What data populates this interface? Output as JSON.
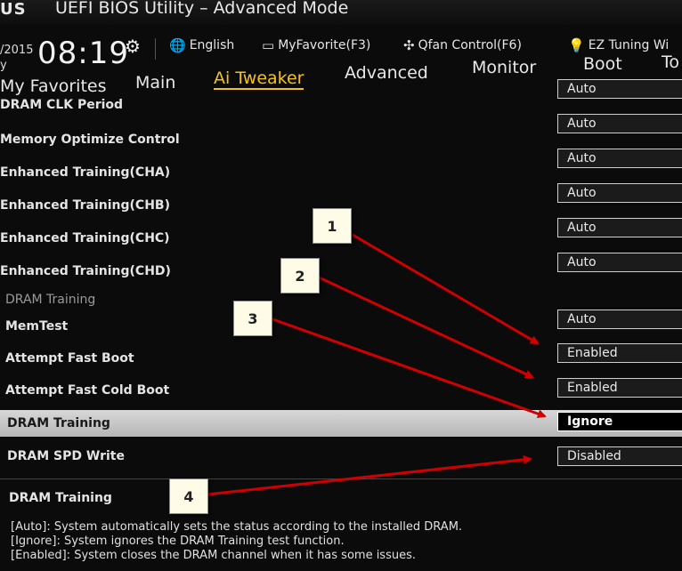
{
  "header": {
    "logo": "US",
    "title": "UEFI BIOS Utility – Advanced Mode",
    "date_line1": "/2015",
    "date_line2": "y",
    "time": "08:19",
    "tools": [
      {
        "label": "English",
        "icon": "globe-icon"
      },
      {
        "label": "MyFavorite(F3)",
        "icon": "favorite-icon"
      },
      {
        "label": "Qfan Control(F6)",
        "icon": "fan-icon"
      },
      {
        "label": "EZ Tuning Wi",
        "icon": "lightbulb-icon"
      }
    ]
  },
  "nav": {
    "tabs": [
      {
        "label": "My Favorites",
        "active": false
      },
      {
        "label": "Main",
        "active": false
      },
      {
        "label": "Ai Tweaker",
        "active": true
      },
      {
        "label": "Advanced",
        "active": false
      },
      {
        "label": "Monitor",
        "active": false
      },
      {
        "label": "Boot",
        "active": false
      },
      {
        "label": "To",
        "active": false
      }
    ],
    "accent_color": "#f3c31b"
  },
  "settings": [
    {
      "label": "",
      "value": "Auto"
    },
    {
      "label": "DRAM CLK Period",
      "value": "Auto"
    },
    {
      "label": "Memory Optimize Control",
      "value": "Auto"
    },
    {
      "label": "Enhanced Training(CHA)",
      "value": "Auto"
    },
    {
      "label": "Enhanced Training(CHB)",
      "value": "Auto"
    },
    {
      "label": "Enhanced Training(CHC)",
      "value": "Auto"
    },
    {
      "label": "Enhanced Training(CHD)",
      "value": ""
    },
    {
      "label": "DRAM Training",
      "value": ""
    },
    {
      "label": "MemTest",
      "value": "Auto"
    },
    {
      "label": "Attempt Fast Boot",
      "value": "Enabled"
    },
    {
      "label": "Attempt Fast Cold Boot",
      "value": "Enabled"
    },
    {
      "label": "DRAM Training",
      "value": "Ignore"
    },
    {
      "label": "DRAM SPD Write",
      "value": "Disabled"
    }
  ],
  "help": {
    "title": "DRAM Training",
    "lines": [
      "[Auto]: System automatically sets the status according to the installed DRAM.",
      "[Ignore]: System ignores the DRAM Training test function.",
      "[Enabled]: System closes the DRAM channel when it has some issues."
    ]
  },
  "annotations": {
    "callouts": [
      "1",
      "2",
      "3",
      "4"
    ],
    "arrow_color": "#d00000"
  }
}
